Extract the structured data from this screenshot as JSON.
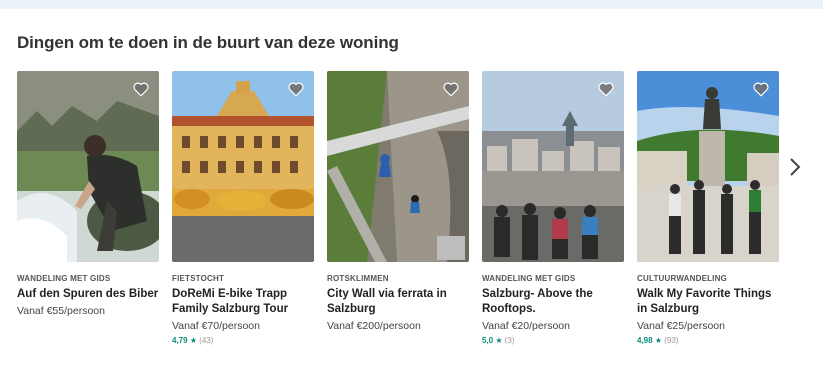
{
  "section": {
    "title": "Dingen om te doen in de buurt van deze woning"
  },
  "cards": [
    {
      "category": "Wandeling met gids",
      "title": "Auf den Spuren des Biber",
      "price": "Vanaf €55/persoon",
      "rating": null,
      "reviews": null,
      "heart_icon": "heart-icon"
    },
    {
      "category": "Fietstocht",
      "title": "DoReMi E-bike Trapp Family Salzburg Tour",
      "price": "Vanaf €70/persoon",
      "rating": "4,79",
      "reviews": "(43)",
      "heart_icon": "heart-icon"
    },
    {
      "category": "Rotsklimmen",
      "title": "City Wall via ferrata in Salzburg",
      "price": "Vanaf €200/persoon",
      "rating": null,
      "reviews": null,
      "heart_icon": "heart-icon"
    },
    {
      "category": "Wandeling met gids",
      "title": "Salzburg- Above the Rooftops.",
      "price": "Vanaf €20/persoon",
      "rating": "5,0",
      "reviews": "(3)",
      "heart_icon": "heart-icon"
    },
    {
      "category": "Cultuurwandeling",
      "title": "Walk My Favorite Things in Salzburg",
      "price": "Vanaf €25/persoon",
      "rating": "4,98",
      "reviews": "(93)",
      "heart_icon": "heart-icon"
    }
  ],
  "star_glyph": "★",
  "navigation": {
    "next_icon": "chevron-right-icon"
  },
  "colors": {
    "rating": "#0d8a7a",
    "top_band": "#eaf3fa"
  }
}
